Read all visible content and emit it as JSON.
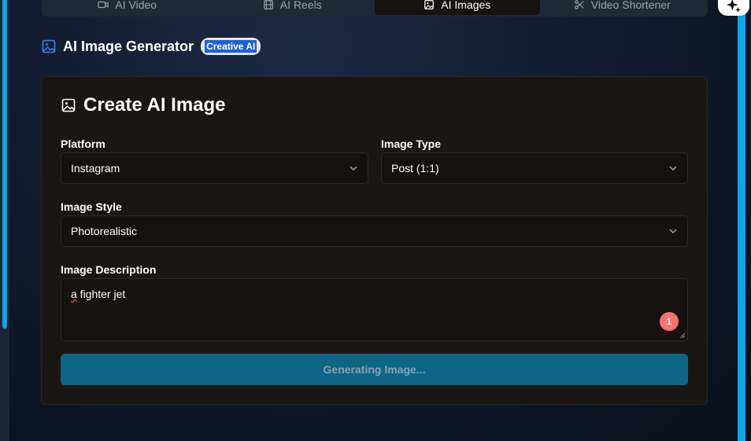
{
  "tabs": [
    {
      "label": "AI Video",
      "icon": "video-icon",
      "active": false
    },
    {
      "label": "AI Reels",
      "icon": "film-icon",
      "active": false
    },
    {
      "label": "AI Images",
      "icon": "image-icon",
      "active": true
    },
    {
      "label": "Video Shortener",
      "icon": "scissors-icon",
      "active": false
    }
  ],
  "header": {
    "title": "AI Image Generator",
    "badge": "Creative AI"
  },
  "card": {
    "title": "Create AI Image",
    "platform": {
      "label": "Platform",
      "value": "Instagram"
    },
    "image_type": {
      "label": "Image Type",
      "value": "Post (1:1)"
    },
    "image_style": {
      "label": "Image Style",
      "value": "Photorealistic"
    },
    "description": {
      "label": "Image Description",
      "value_first": "a",
      "value_rest": " fighter jet",
      "issue_count": "1"
    },
    "generate_button": "Generating Image..."
  },
  "colors": {
    "accent": "#0ea5e9",
    "button": "#0e6585",
    "badge_highlight": "#1e5fd8",
    "issue_badge": "#f87171"
  }
}
